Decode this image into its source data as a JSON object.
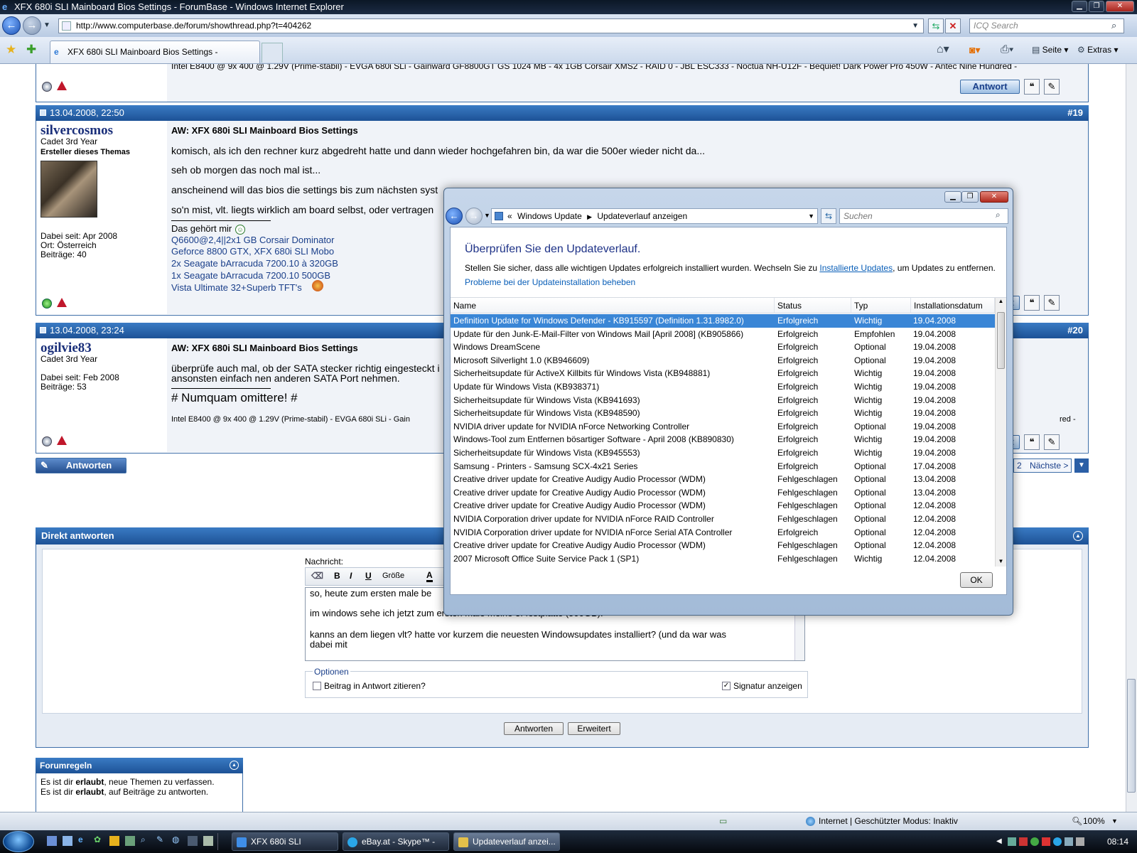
{
  "browser": {
    "title": "XFX 680i SLI Mainboard Bios Settings - ForumBase - Windows Internet Explorer",
    "url": "http://www.computerbase.de/forum/showthread.php?t=404262",
    "search_placeholder": "ICQ Search",
    "tab_label": "XFX 680i SLI Mainboard Bios Settings - ForumBase",
    "cmd_seite": "Seite",
    "cmd_extras": "Extras"
  },
  "forum": {
    "top_sig": "Intel E8400 @ 9x 400 @ 1.29V (Prime-stabil) - EVGA 680i SLi - Gainward GF8800GT GS 1024 MB - 4x 1GB Corsair XMS2 - RAID 0 - JBL ESC333 - Noctua NH-U12F - Bequiet! Dark Power Pro 450W - Antec Nine Hundred -",
    "antwort": "Antwort",
    "post19": {
      "date": "13.04.2008, 22:50",
      "num": "#19",
      "user": "silvercosmos",
      "rank": "Cadet 3rd Year",
      "role": "Ersteller dieses Themas",
      "joined": "Dabei seit: Apr 2008",
      "location": "Ort: Österreich",
      "posts": "Beiträge: 40",
      "title": "AW: XFX 680i SLI Mainboard Bios Settings",
      "lines": [
        "komisch, als ich den rechner kurz abgedreht hatte und dann wieder hochgefahren bin, da war die 500er wieder nicht da...",
        "seh ob morgen das noch mal ist...",
        "anscheinend will das bios die settings bis zum nächsten syst",
        "so'n mist, vlt. liegts wirklich am board selbst, oder vertragen"
      ],
      "sig_head": "Das gehört mir",
      "sig": [
        "Q6600@2,4||2x1 GB Corsair Dominator",
        "Geforce 8800 GTX, XFX 680i SLI Mobo",
        "2x Seagate bArracuda 7200.10 à 320GB",
        "1x Seagate bArracuda 7200.10 500GB",
        "Vista Ultimate 32+Superb TFT's"
      ],
      "btn": "wort"
    },
    "post20": {
      "date": "13.04.2008, 23:24",
      "num": "#20",
      "user": "ogilvie83",
      "rank": "Cadet 3rd Year",
      "joined": "Dabei seit: Feb 2008",
      "posts": "Beiträge: 53",
      "title": "AW: XFX 680i SLI Mainboard Bios Settings",
      "lines": [
        "überprüfe auch mal, ob der SATA stecker richtig eingesteckt i",
        "ansonsten einfach nen anderen SATA Port nehmen."
      ],
      "sig_title": "# Numquam omittere! #",
      "sig": "Intel E8400 @ 9x 400 @ 1.29V (Prime-stabil) - EVGA 680i SLi - Gain",
      "sig_end": "red -",
      "btn": "wort"
    },
    "antworten_btn": "Antworten",
    "pagination": {
      "page": "2",
      "next": "Nächste >"
    },
    "quick": {
      "title": "Direkt antworten",
      "label": "Nachricht:",
      "size": "Größe",
      "text": [
        "so, heute zum ersten male be",
        "im windows sehe ich jetzt zum ersten male meine 3. festplatte (500GB)!",
        "kanns an dem liegen vlt? hatte vor kurzem die neuesten Windowsupdates installiert? (und da war was",
        "dabei mit"
      ],
      "options": "Optionen",
      "quote": "Beitrag in Antwort zitieren?",
      "signature": "Signatur anzeigen",
      "reply": "Antworten",
      "advanced": "Erweitert"
    },
    "rules": {
      "title": "Forumregeln",
      "line1_pre": "Es ist dir ",
      "line1_b": "erlaubt",
      "line1_post": ", neue Themen zu verfassen.",
      "line2_pre": "Es ist dir ",
      "line2_b": "erlaubt",
      "line2_post": ", auf Beiträge zu antworten."
    }
  },
  "dialog": {
    "crumb1": "Windows Update",
    "crumb2": "Updateverlauf anzeigen",
    "crumb_prefix": "«",
    "search": "Suchen",
    "heading": "Überprüfen Sie den Updateverlauf.",
    "desc_pre": "Stellen Sie sicher, dass alle wichtigen Updates erfolgreich installiert wurden. Wechseln Sie zu ",
    "desc_link": "Installierte Updates",
    "desc_post": ", um Updates zu entfernen.",
    "help_link": "Probleme bei der Updateinstallation beheben",
    "columns": [
      "Name",
      "Status",
      "Typ",
      "Installationsdatum"
    ],
    "rows": [
      [
        "Definition Update for Windows Defender - KB915597 (Definition 1.31.8982.0)",
        "Erfolgreich",
        "Wichtig",
        "19.04.2008"
      ],
      [
        "Update für den Junk-E-Mail-Filter von Windows Mail [April 2008] (KB905866)",
        "Erfolgreich",
        "Empfohlen",
        "19.04.2008"
      ],
      [
        "Windows DreamScene",
        "Erfolgreich",
        "Optional",
        "19.04.2008"
      ],
      [
        "Microsoft Silverlight 1.0 (KB946609)",
        "Erfolgreich",
        "Optional",
        "19.04.2008"
      ],
      [
        "Sicherheitsupdate für ActiveX Killbits für Windows Vista (KB948881)",
        "Erfolgreich",
        "Wichtig",
        "19.04.2008"
      ],
      [
        "Update für Windows Vista (KB938371)",
        "Erfolgreich",
        "Wichtig",
        "19.04.2008"
      ],
      [
        "Sicherheitsupdate für Windows Vista (KB941693)",
        "Erfolgreich",
        "Wichtig",
        "19.04.2008"
      ],
      [
        "Sicherheitsupdate für Windows Vista (KB948590)",
        "Erfolgreich",
        "Wichtig",
        "19.04.2008"
      ],
      [
        "NVIDIA driver update for NVIDIA nForce Networking Controller",
        "Erfolgreich",
        "Optional",
        "19.04.2008"
      ],
      [
        "Windows-Tool zum Entfernen bösartiger Software - April 2008 (KB890830)",
        "Erfolgreich",
        "Wichtig",
        "19.04.2008"
      ],
      [
        "Sicherheitsupdate für Windows Vista (KB945553)",
        "Erfolgreich",
        "Wichtig",
        "19.04.2008"
      ],
      [
        "Samsung - Printers - Samsung SCX-4x21 Series",
        "Erfolgreich",
        "Optional",
        "17.04.2008"
      ],
      [
        "Creative driver update for Creative Audigy Audio Processor (WDM)",
        "Fehlgeschlagen",
        "Optional",
        "13.04.2008"
      ],
      [
        "Creative driver update for Creative Audigy Audio Processor (WDM)",
        "Fehlgeschlagen",
        "Optional",
        "13.04.2008"
      ],
      [
        "Creative driver update for Creative Audigy Audio Processor (WDM)",
        "Fehlgeschlagen",
        "Optional",
        "12.04.2008"
      ],
      [
        "NVIDIA Corporation driver update for NVIDIA nForce RAID Controller",
        "Fehlgeschlagen",
        "Optional",
        "12.04.2008"
      ],
      [
        "NVIDIA Corporation driver update for NVIDIA nForce Serial ATA Controller",
        "Erfolgreich",
        "Optional",
        "12.04.2008"
      ],
      [
        "Creative driver update for Creative Audigy Audio Processor (WDM)",
        "Fehlgeschlagen",
        "Optional",
        "12.04.2008"
      ],
      [
        "2007 Microsoft Office Suite Service Pack 1 (SP1)",
        "Fehlgeschlagen",
        "Wichtig",
        "12.04.2008"
      ]
    ],
    "ok": "OK"
  },
  "status": {
    "zone": "Internet | Geschützter Modus: Inaktiv",
    "zoom": "100%"
  },
  "taskbar": {
    "items": [
      "XFX 680i SLI Mainbo...",
      "eBay.at - Skype™ - d...",
      "Updateverlauf anzei..."
    ],
    "clock": "08:14"
  },
  "colors": {
    "accent": "#1d5296",
    "selection": "#3a86d6",
    "link": "#1a3f8a"
  }
}
